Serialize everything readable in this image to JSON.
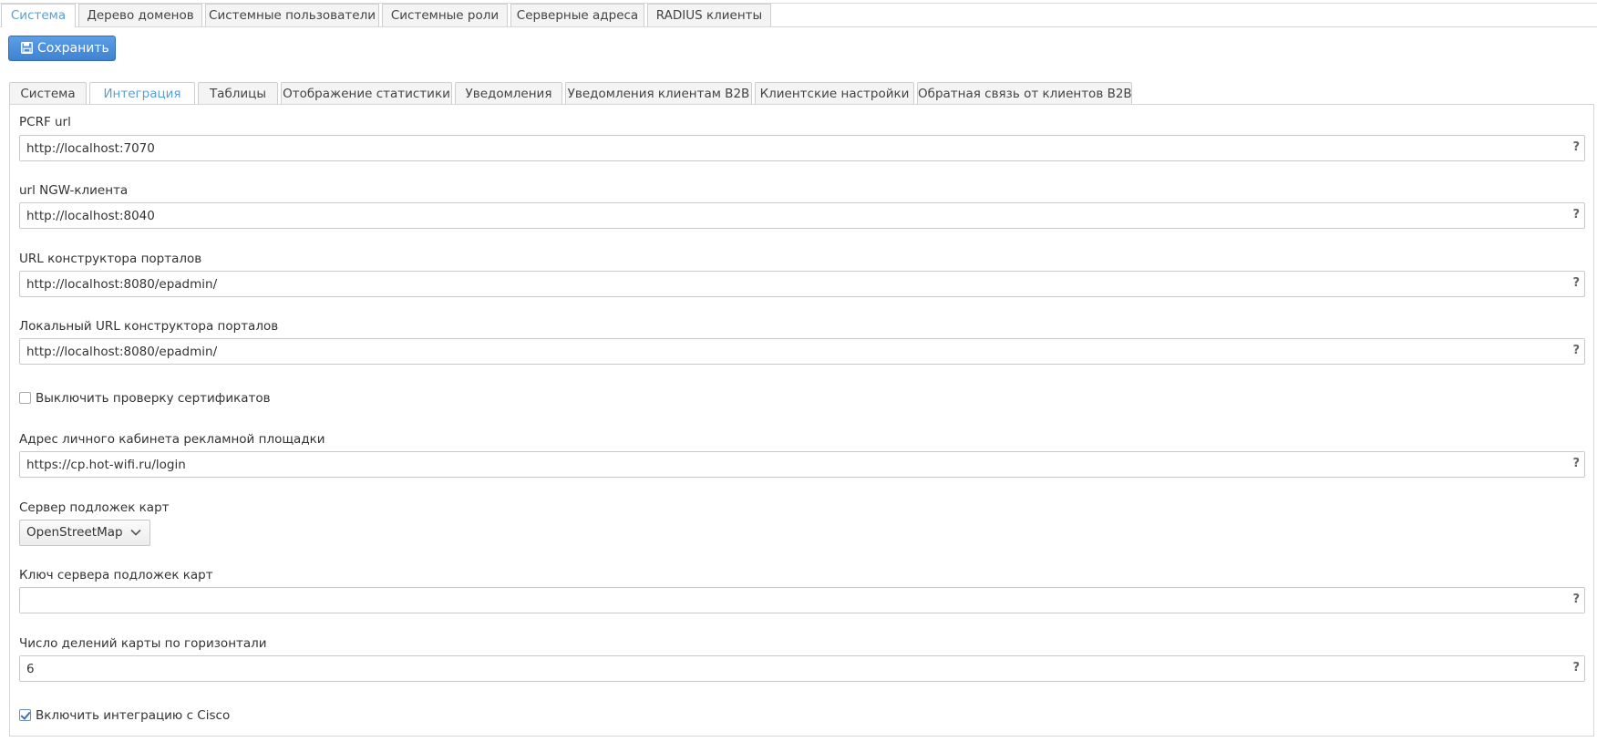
{
  "top_tabs": [
    {
      "label": "Система",
      "active": true
    },
    {
      "label": "Дерево доменов",
      "active": false
    },
    {
      "label": "Системные пользователи",
      "active": false
    },
    {
      "label": "Системные роли",
      "active": false
    },
    {
      "label": "Серверные адреса",
      "active": false
    },
    {
      "label": "RADIUS клиенты",
      "active": false
    }
  ],
  "toolbar": {
    "save_label": "Сохранить",
    "save_icon": "floppy-disk-icon"
  },
  "sub_tabs": [
    {
      "label": "Система",
      "active": false
    },
    {
      "label": "Интеграция",
      "active": true
    },
    {
      "label": "Таблицы",
      "active": false
    },
    {
      "label": "Отображение статистики",
      "active": false
    },
    {
      "label": "Уведомления",
      "active": false
    },
    {
      "label": "Уведомления клиентам B2B",
      "active": false
    },
    {
      "label": "Клиентские настройки",
      "active": false
    },
    {
      "label": "Обратная связь от клиентов B2B",
      "active": false
    }
  ],
  "form": {
    "pcrf_url": {
      "label": "PCRF url",
      "value": "http://localhost:7070"
    },
    "ngw_url": {
      "label": "url NGW-клиента",
      "value": "http://localhost:8040"
    },
    "portal_builder_url": {
      "label": "URL конструктора порталов",
      "value": "http://localhost:8080/epadmin/"
    },
    "local_portal_builder_url": {
      "label": "Локальный URL конструктора порталов",
      "value": "http://localhost:8080/epadmin/"
    },
    "disable_cert_check": {
      "label": "Выключить проверку сертификатов",
      "checked": false
    },
    "ad_cabinet_url": {
      "label": "Адрес личного кабинета рекламной площадки",
      "value": "https://cp.hot-wifi.ru/login"
    },
    "map_tile_server": {
      "label": "Сервер подложек карт",
      "selected": "OpenStreetMap"
    },
    "map_tile_key": {
      "label": "Ключ сервера подложек карт",
      "value": ""
    },
    "map_h_divisions": {
      "label": "Число делений карты по горизонтали",
      "value": "6"
    },
    "cisco_integration": {
      "label": "Включить интеграцию с Cisco",
      "checked": true
    }
  },
  "help_glyph": "?",
  "colors": {
    "accent": "#5a9fd4",
    "save_button": "#4a8fdc"
  }
}
